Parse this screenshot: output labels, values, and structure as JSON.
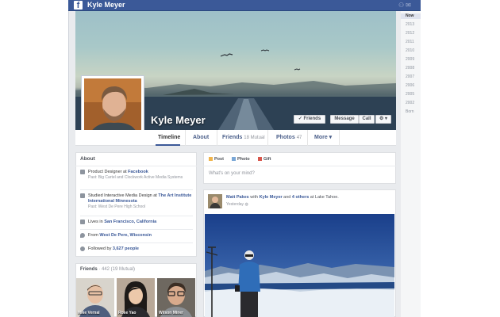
{
  "topbar": {
    "logo": "f",
    "name": "Kyle Meyer",
    "icons": [
      "friend-requests-icon",
      "messages-icon"
    ]
  },
  "profile": {
    "name": "Kyle Meyer",
    "actions": {
      "friends": "✓ Friends",
      "message": "Message",
      "call": "Call",
      "gear": "⚙ ▾"
    }
  },
  "tabs": [
    {
      "label": "Timeline",
      "count": ""
    },
    {
      "label": "About",
      "count": ""
    },
    {
      "label": "Friends",
      "count": "18 Mutual"
    },
    {
      "label": "Photos",
      "count": "47"
    },
    {
      "label": "More ▾",
      "count": ""
    }
  ],
  "about": {
    "title": "About",
    "work1": {
      "text": "Product Designer at ",
      "link": "Facebook",
      "sub": "Past: Big Cartel and Clockwork Active Media Systems"
    },
    "edu": {
      "text": "Studied Interactive Media Design at ",
      "link": "The Art Institute International Minnesota",
      "sub": "Past: West De Pere High School"
    },
    "lives": {
      "text": "Lives in ",
      "link": "San Francisco, California"
    },
    "from": {
      "text": "From ",
      "link": "West De Pere, Wisconsin"
    },
    "followed": {
      "text": "Followed by ",
      "link": "3,627 people"
    }
  },
  "friends": {
    "title": "Friends",
    "count": "· 442 (19 Mutual)",
    "items": [
      {
        "name": "Mike Vernal"
      },
      {
        "name": "Rose Yao"
      },
      {
        "name": "Wilson Miner"
      }
    ]
  },
  "composer": {
    "tabs": [
      {
        "label": "Post"
      },
      {
        "label": "Photo"
      },
      {
        "label": "Gift"
      }
    ],
    "placeholder": "What's on your mind?"
  },
  "story": {
    "author": "Matt Pakes",
    "with_text": " with ",
    "tagged": "Kyle Meyer",
    "and_text": " and ",
    "others": "4 others",
    "at_text": " at Lake Tahoe.",
    "time": "Yesterday",
    "audience_icon": "globe-icon"
  },
  "scrubber": {
    "years": [
      "Now",
      "2013",
      "2012",
      "2011",
      "2010",
      "2009",
      "2008",
      "2007",
      "2006",
      "2005",
      "2002",
      "Born"
    ]
  },
  "colors": {
    "brand": "#3b5998",
    "link": "#3b5998",
    "muted": "#90949c"
  }
}
